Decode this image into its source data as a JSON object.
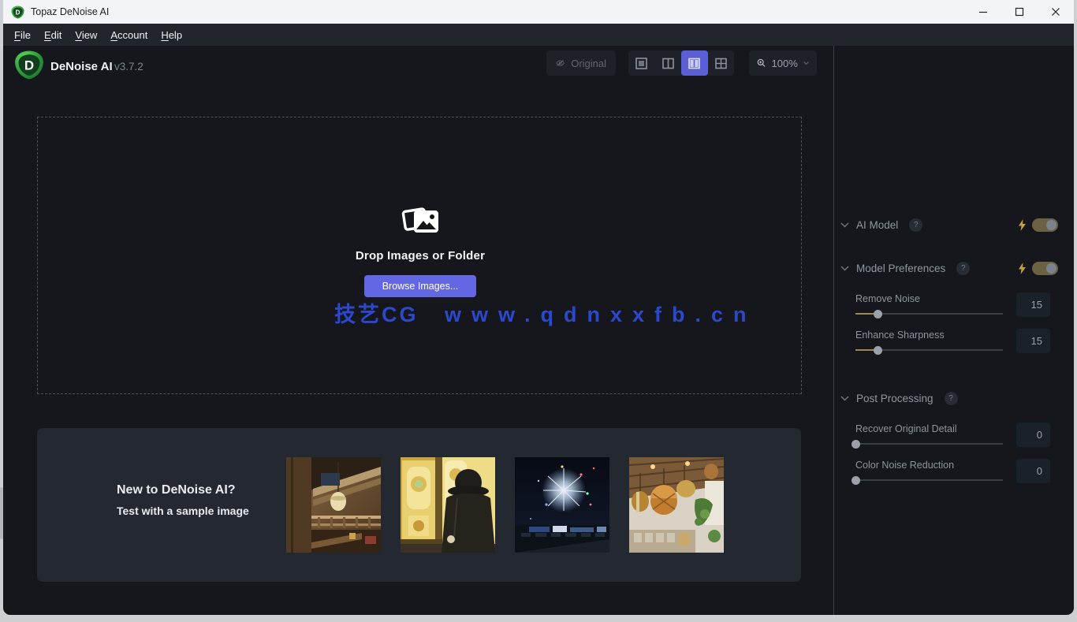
{
  "window": {
    "title": "Topaz DeNoise AI"
  },
  "menu": {
    "items": [
      "File",
      "Edit",
      "View",
      "Account",
      "Help"
    ]
  },
  "header": {
    "app_name": "DeNoise AI",
    "version": "v3.7.2",
    "original_label": "Original",
    "zoom_level": "100%"
  },
  "dropzone": {
    "title": "Drop Images or Folder",
    "browse_label": "Browse Images...",
    "watermark_brand": "技艺CG",
    "watermark_url": "www.qdnxxfb.cn"
  },
  "samples": {
    "heading": "New to DeNoise AI?",
    "subheading": "Test with a sample image",
    "thumbnails": [
      {
        "name": "lodge-interior"
      },
      {
        "name": "stained-glass-window"
      },
      {
        "name": "fireworks-night"
      },
      {
        "name": "cafe-hanging-baskets"
      }
    ]
  },
  "sidebar": {
    "ai_model": {
      "label": "AI Model",
      "help": "?",
      "toggle_on": true
    },
    "model_preferences": {
      "label": "Model Preferences",
      "help": "?",
      "toggle_on": true
    },
    "remove_noise": {
      "label": "Remove Noise",
      "value": 15
    },
    "enhance_sharpness": {
      "label": "Enhance Sharpness",
      "value": 15
    },
    "post_processing": {
      "label": "Post Processing",
      "help": "?"
    },
    "recover_original_detail": {
      "label": "Recover Original Detail",
      "value": 0
    },
    "color_noise_reduction": {
      "label": "Color Noise Reduction",
      "value": 0
    }
  },
  "colors": {
    "app_background": "#15171c",
    "accent_active_view": "#5a5fd3",
    "browse_button": "#6467e4",
    "slider_fill_gold": "#9c8a4a",
    "toggle_olive": "#6b6243",
    "watermark_blue": "#2b49cf",
    "logo_green": "#3fae49",
    "panel_background": "#232831"
  }
}
